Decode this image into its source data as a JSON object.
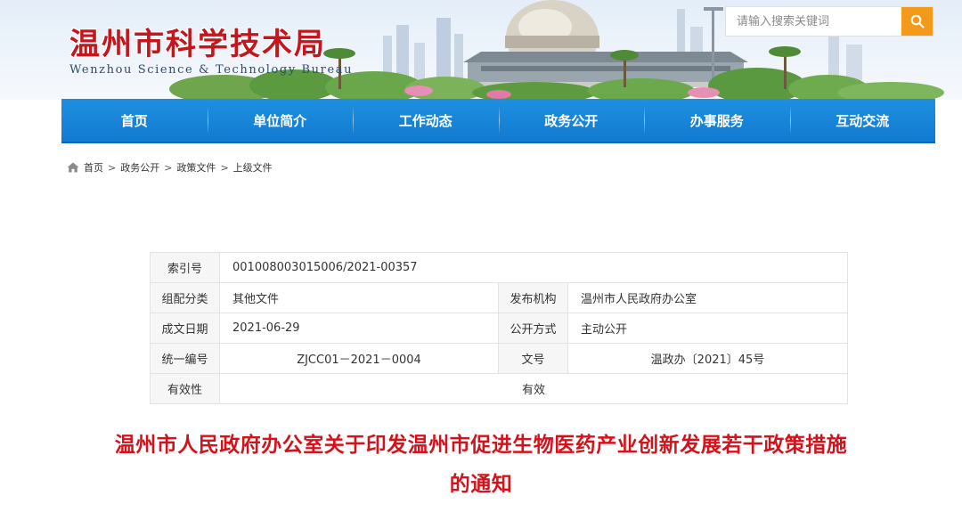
{
  "header": {
    "title": "温州市科学技术局",
    "subtitle": "Wenzhou Science & Technology Bureau",
    "search": {
      "placeholder": "请输入搜索关键词",
      "button_icon": "search-icon"
    }
  },
  "nav": {
    "items": [
      {
        "label": "首页"
      },
      {
        "label": "单位简介"
      },
      {
        "label": "工作动态"
      },
      {
        "label": "政务公开"
      },
      {
        "label": "办事服务"
      },
      {
        "label": "互动交流"
      }
    ]
  },
  "breadcrumb": {
    "home_icon": "home-icon",
    "items": [
      "首页",
      "政务公开",
      "政策文件",
      "上级文件"
    ],
    "separator": ">"
  },
  "info": {
    "index_no": {
      "label": "索引号",
      "value": "001008003015006/2021-00357"
    },
    "category": {
      "label": "组配分类",
      "value": "其他文件"
    },
    "publisher": {
      "label": "发布机构",
      "value": "温州市人民政府办公室"
    },
    "date": {
      "label": "成文日期",
      "value": "2021-06-29"
    },
    "disclosure": {
      "label": "公开方式",
      "value": "主动公开"
    },
    "unified_no": {
      "label": "统一编号",
      "value": "ZJCC01－2021－0004"
    },
    "doc_no": {
      "label": "文号",
      "value": "温政办〔2021〕45号"
    },
    "validity": {
      "label": "有效性",
      "value": "有效"
    }
  },
  "document": {
    "title_line1": "温州市人民政府办公室关于印发温州市促进生物医药产业创新发展若干政策措施",
    "title_line2": "的通知"
  },
  "colors": {
    "nav_blue": "#1686d9",
    "title_red": "#d4121b",
    "search_orange": "#f39a1a"
  }
}
